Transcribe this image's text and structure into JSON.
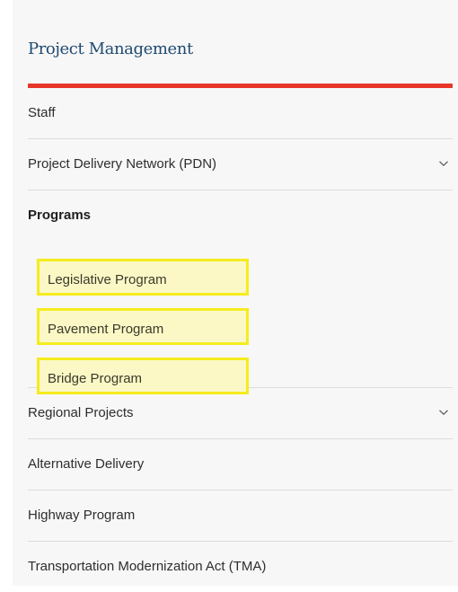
{
  "nav": {
    "title": "Project Management",
    "accent_color": "#e8362a",
    "items": [
      {
        "label": "Staff",
        "has_chevron": false
      },
      {
        "label": "Project Delivery Network (PDN)",
        "has_chevron": true,
        "chevron_icon": "chevron-down-icon"
      }
    ],
    "group": {
      "heading": "Programs",
      "highlight_color": "#f5ec1e",
      "subitems": [
        {
          "label": "Legislative Program"
        },
        {
          "label": "Pavement Program"
        },
        {
          "label": "Bridge Program"
        }
      ]
    },
    "items_after": [
      {
        "label": "Regional Projects",
        "has_chevron": true,
        "chevron_icon": "chevron-down-icon"
      },
      {
        "label": "Alternative Delivery",
        "has_chevron": false
      },
      {
        "label": "Highway Program",
        "has_chevron": false
      },
      {
        "label": "Transportation Modernization Act (TMA)",
        "has_chevron": false
      }
    ]
  }
}
